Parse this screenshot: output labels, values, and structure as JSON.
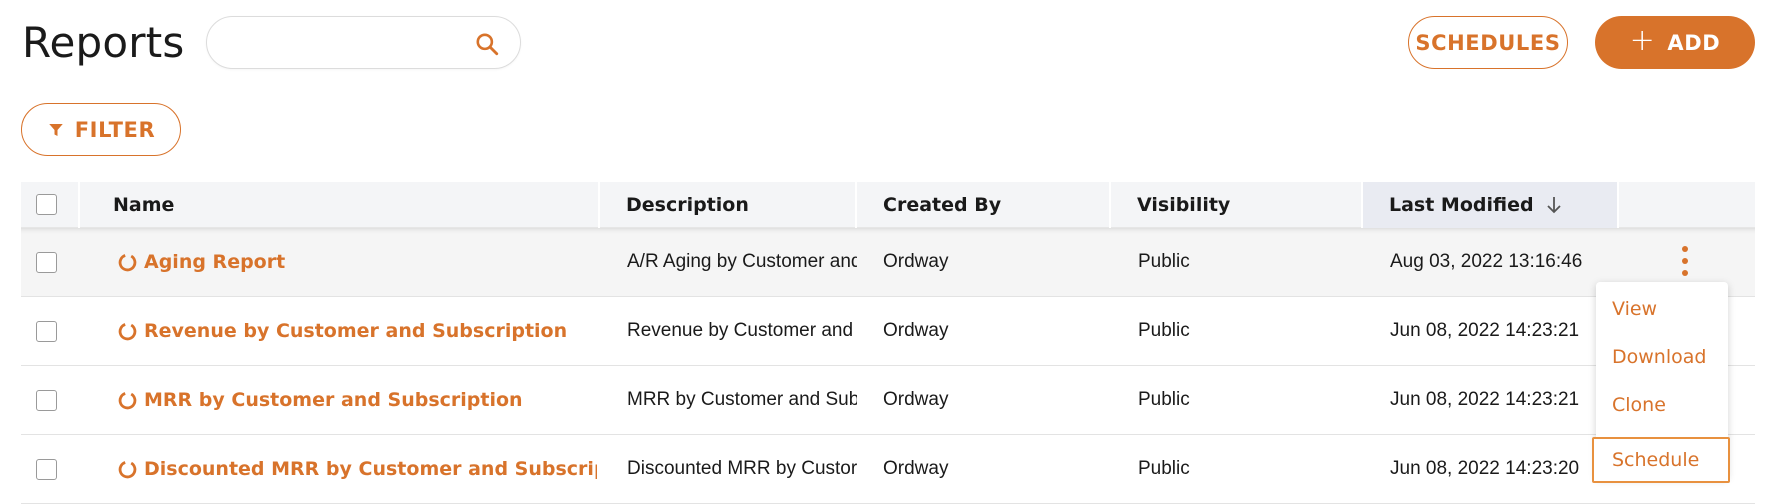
{
  "header": {
    "title": "Reports",
    "search": {
      "value": "",
      "placeholder": "",
      "icon": "search-icon"
    },
    "schedules_label": "SCHEDULES",
    "add_label": "ADD"
  },
  "filter": {
    "label": "FILTER",
    "icon": "filter-icon"
  },
  "table": {
    "columns": [
      {
        "key": "name",
        "label": "Name"
      },
      {
        "key": "description",
        "label": "Description"
      },
      {
        "key": "created_by",
        "label": "Created By"
      },
      {
        "key": "visibility",
        "label": "Visibility"
      },
      {
        "key": "last_modified",
        "label": "Last Modified",
        "sort": "descending"
      }
    ],
    "rows": [
      {
        "name": "Aging Report",
        "description": "A/R Aging by Customer and",
        "created_by": "Ordway",
        "visibility": "Public",
        "last_modified": "Aug 03, 2022 13:16:46"
      },
      {
        "name": "Revenue by Customer and Subscription",
        "description": "Revenue by Customer and",
        "created_by": "Ordway",
        "visibility": "Public",
        "last_modified": "Jun 08, 2022 14:23:21"
      },
      {
        "name": "MRR by Customer and Subscription",
        "description": "MRR by Customer and Sub",
        "created_by": "Ordway",
        "visibility": "Public",
        "last_modified": "Jun 08, 2022 14:23:21"
      },
      {
        "name": "Discounted MRR by Customer and Subscription",
        "description": "Discounted MRR by Custor",
        "created_by": "Ordway",
        "visibility": "Public",
        "last_modified": "Jun 08, 2022 14:23:20"
      }
    ]
  },
  "row_menu": {
    "items": [
      "View",
      "Download",
      "Clone",
      "Schedule"
    ],
    "focused": "Schedule"
  },
  "colors": {
    "accent": "#d8732b",
    "header_bg": "#f4f5f7"
  }
}
